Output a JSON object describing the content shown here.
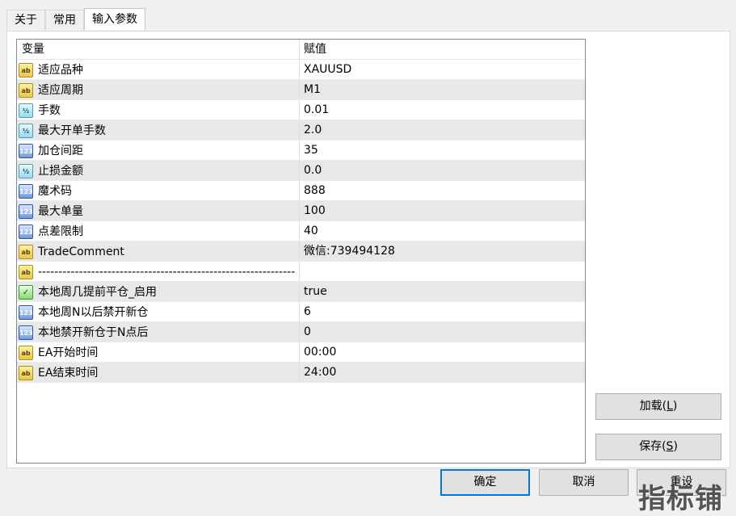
{
  "tabs": [
    {
      "label": "关于",
      "active": false
    },
    {
      "label": "常用",
      "active": false
    },
    {
      "label": "输入参数",
      "active": true
    }
  ],
  "grid": {
    "headers": {
      "variable": "变量",
      "value": "赋值"
    },
    "rows": [
      {
        "icon": "ab",
        "name": "适应品种",
        "value": "XAUUSD"
      },
      {
        "icon": "ab",
        "name": "适应周期",
        "value": "M1"
      },
      {
        "icon": "half",
        "name": "手数",
        "value": "0.01"
      },
      {
        "icon": "half",
        "name": "最大开单手数",
        "value": "2.0"
      },
      {
        "icon": "123",
        "name": "加仓间距",
        "value": "35"
      },
      {
        "icon": "half",
        "name": "止损金额",
        "value": "0.0"
      },
      {
        "icon": "123",
        "name": "魔术码",
        "value": "888"
      },
      {
        "icon": "123",
        "name": "最大单量",
        "value": "100"
      },
      {
        "icon": "123",
        "name": "点差限制",
        "value": "40"
      },
      {
        "icon": "ab",
        "name": "TradeComment",
        "value": "微信:739494128"
      },
      {
        "icon": "ab",
        "name": "---------------------------------------------------------------",
        "value": ""
      },
      {
        "icon": "bool",
        "name": "本地周几提前平仓_启用",
        "value": "true"
      },
      {
        "icon": "123",
        "name": "本地周N以后禁开新仓",
        "value": "6"
      },
      {
        "icon": "123",
        "name": "本地禁开新仓于N点后",
        "value": "0"
      },
      {
        "icon": "ab",
        "name": "EA开始时间",
        "value": "00:00"
      },
      {
        "icon": "ab",
        "name": "EA结束时间",
        "value": "24:00"
      }
    ]
  },
  "icons": {
    "ab": {
      "glyph": "ab",
      "semantic": "string-type-icon"
    },
    "half": {
      "glyph": "½",
      "semantic": "double-type-icon"
    },
    "123": {
      "glyph": "123",
      "semantic": "integer-type-icon"
    },
    "bool": {
      "glyph": "✓",
      "semantic": "bool-type-icon"
    }
  },
  "buttons": {
    "load": {
      "label": "加载(",
      "mnemonic": "L",
      "suffix": ")"
    },
    "save": {
      "label": "保存(",
      "mnemonic": "S",
      "suffix": ")"
    },
    "ok": {
      "label": "确定"
    },
    "cancel": {
      "label": "取消"
    },
    "reset": {
      "label": "重设"
    }
  },
  "watermark": "指标铺",
  "colors": {
    "accent": "#0078d7",
    "alt_row": "#e8e8e8"
  }
}
